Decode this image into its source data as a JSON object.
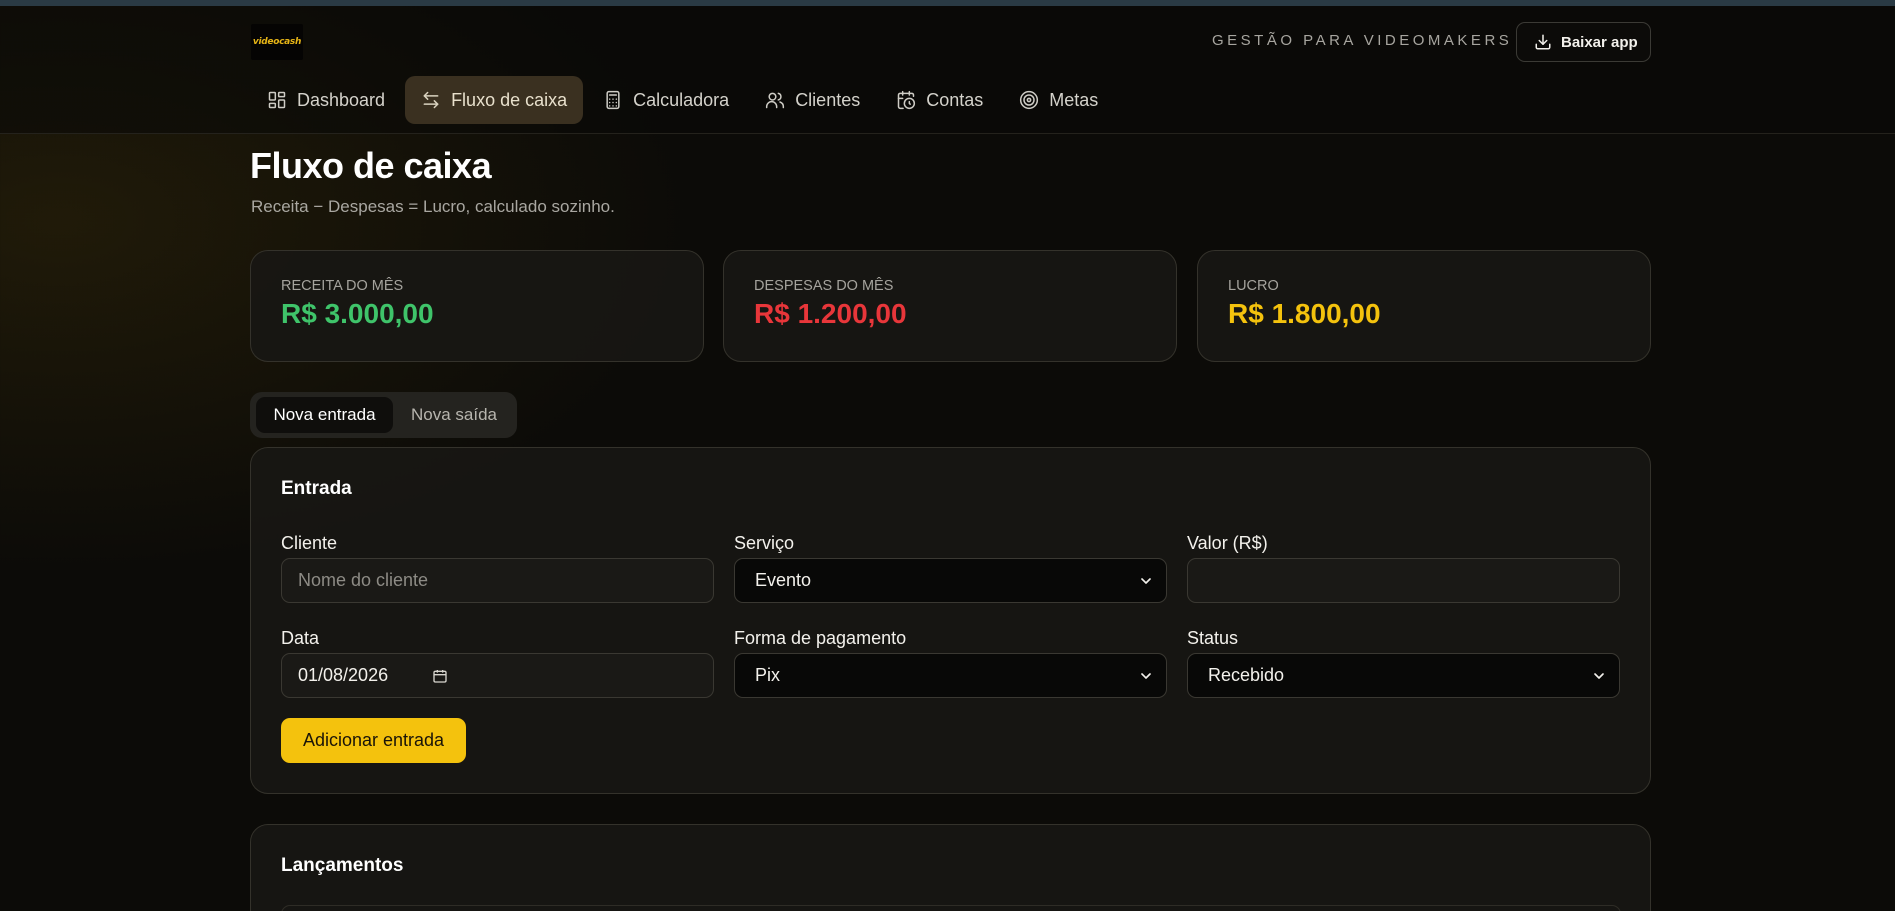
{
  "app": {
    "logo_text": "videocash",
    "tagline": "GESTÃO PARA VIDEOMAKERS",
    "download_label": "Baixar app"
  },
  "nav": {
    "items": [
      {
        "label": "Dashboard",
        "icon": "dashboard-icon",
        "active": false
      },
      {
        "label": "Fluxo de caixa",
        "icon": "arrows-exchange-icon",
        "active": true
      },
      {
        "label": "Calculadora",
        "icon": "calculator-icon",
        "active": false
      },
      {
        "label": "Clientes",
        "icon": "users-icon",
        "active": false
      },
      {
        "label": "Contas",
        "icon": "calendar-clock-icon",
        "active": false
      },
      {
        "label": "Metas",
        "icon": "target-icon",
        "active": false
      }
    ]
  },
  "page": {
    "title": "Fluxo de caixa",
    "subtitle": "Receita − Despesas = Lucro, calculado sozinho."
  },
  "summary": {
    "revenue": {
      "label": "RECEITA DO MÊS",
      "value": "R$ 3.000,00",
      "color": "#3fc46a"
    },
    "expenses": {
      "label": "DESPESAS DO MÊS",
      "value": "R$ 1.200,00",
      "color": "#e8363a"
    },
    "profit": {
      "label": "LUCRO",
      "value": "R$ 1.800,00",
      "color": "#f4c20d"
    }
  },
  "toggle": {
    "entry_label": "Nova entrada",
    "exit_label": "Nova saída",
    "selected": "Nova entrada"
  },
  "form": {
    "title": "Entrada",
    "client": {
      "label": "Cliente",
      "placeholder": "Nome do cliente",
      "value": ""
    },
    "service": {
      "label": "Serviço",
      "value": "Evento"
    },
    "amount": {
      "label": "Valor (R$)",
      "value": ""
    },
    "date": {
      "label": "Data",
      "value": "01/08/2026"
    },
    "payment": {
      "label": "Forma de pagamento",
      "value": "Pix"
    },
    "status": {
      "label": "Status",
      "value": "Recebido"
    },
    "submit_label": "Adicionar entrada"
  },
  "entries": {
    "title": "Lançamentos"
  },
  "colors": {
    "accent": "#f4c20d",
    "background": "#0c0b08",
    "card": "#181714"
  }
}
